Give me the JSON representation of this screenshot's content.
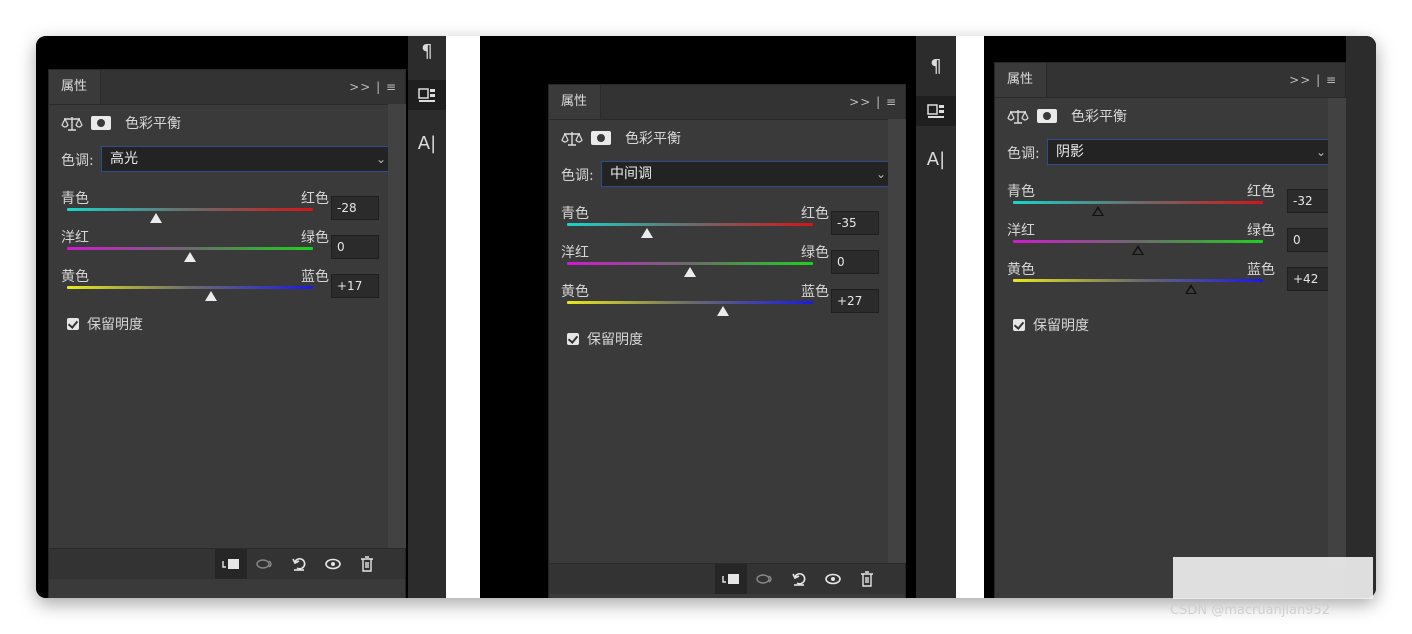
{
  "panel_tab": "属性",
  "header_controls": ">> | ≡",
  "adjustment_label": "色彩平衡",
  "tone_label": "色调:",
  "preserve_label": "保留明度",
  "slider_labels": {
    "cyan": "青色",
    "red": "红色",
    "magenta": "洋红",
    "green": "绿色",
    "yellow": "黄色",
    "blue": "蓝色"
  },
  "panels": [
    {
      "tone": "高光",
      "values": [
        "-28",
        "0",
        "+17"
      ]
    },
    {
      "tone": "中间调",
      "values": [
        "-35",
        "0",
        "+27"
      ]
    },
    {
      "tone": "阴影",
      "values": [
        "-32",
        "0",
        "+42"
      ]
    }
  ],
  "slider_positions": [
    [
      0.36,
      0.5,
      0.585
    ],
    [
      0.325,
      0.5,
      0.635
    ],
    [
      0.34,
      0.5,
      0.71
    ]
  ],
  "tools": {
    "paragraph": "¶",
    "character": "A|"
  },
  "watermark": "CSDN @macruanjian952"
}
